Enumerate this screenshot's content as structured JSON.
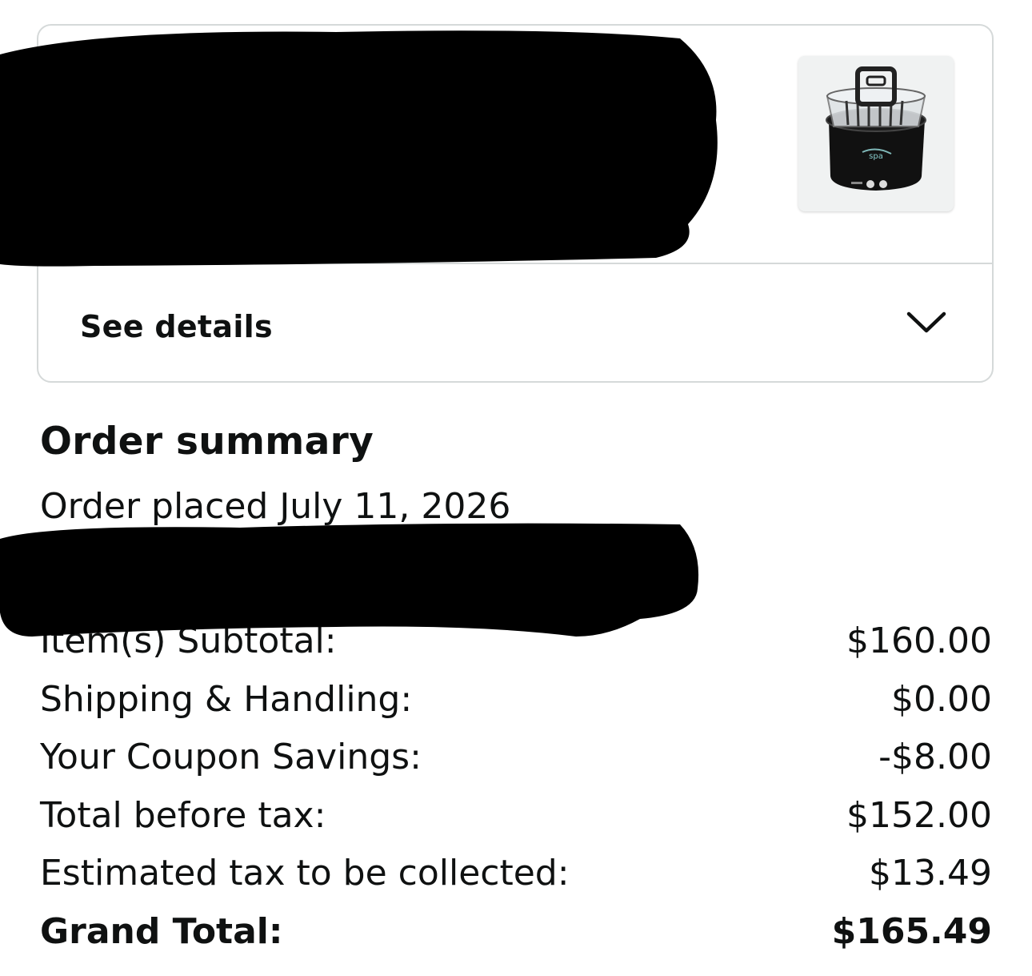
{
  "item": {
    "thumbnail_alt": "Foot spa bath product image",
    "details_label": "See details",
    "chevron_icon": "chevron-down-icon"
  },
  "summary": {
    "title": "Order summary",
    "order_placed": "Order placed July 11, 2026",
    "lines": [
      {
        "label": "Item(s) Subtotal:",
        "value": "$160.00"
      },
      {
        "label": "Shipping & Handling:",
        "value": "$0.00"
      },
      {
        "label": "Your Coupon Savings:",
        "value": "-$8.00"
      },
      {
        "label": "Total before tax:",
        "value": "$152.00"
      },
      {
        "label": "Estimated tax to be collected:",
        "value": "$13.49"
      }
    ],
    "grand_total": {
      "label": "Grand Total:",
      "value": "$165.49"
    }
  },
  "colors": {
    "text": "#0f1111",
    "border": "#d5d9d9",
    "redaction": "#000000"
  }
}
